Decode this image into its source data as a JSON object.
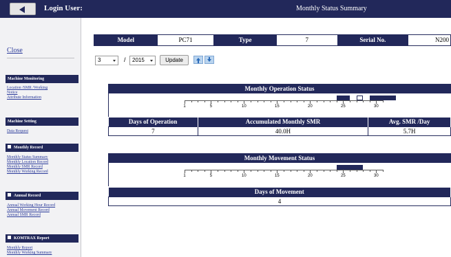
{
  "header": {
    "login_label": "Login User:",
    "page_title": "Monthly Status Summary"
  },
  "sidebar": {
    "close_label": "Close",
    "sections": [
      {
        "title": "Machine Monitoring",
        "has_minus": false,
        "links": [
          "Location /SMR /Working",
          "Notice",
          "Attribute Information"
        ]
      },
      {
        "title": "Machine Setting",
        "has_minus": false,
        "links": [
          "Data Request"
        ]
      },
      {
        "title": "Monthly Record",
        "has_minus": true,
        "links": [
          "Monthly Status Summary",
          "Monthly Location Record",
          "Monthly SMR Record",
          "Monthly Working Record"
        ]
      },
      {
        "title": "Annual Record",
        "has_minus": true,
        "links": [
          "Annual Working Hour Record",
          "Annual Movement Record",
          "Annual SMR Record"
        ]
      },
      {
        "title": "KOMTRAX Report",
        "has_minus": true,
        "links": [
          "Monthly Report",
          "Monthly Working Summary"
        ]
      }
    ]
  },
  "machine": {
    "model_label": "Model",
    "model_value": "PC71",
    "type_label": "Type",
    "type_value": "7",
    "serial_label": "Serial No.",
    "serial_value": "N200"
  },
  "controls": {
    "month_value": "3",
    "separator": "/",
    "year_value": "2015",
    "update_label": "Update"
  },
  "operation": {
    "title": "Monthly Operation Status",
    "axis_labels": [
      "1",
      "5",
      "10",
      "15",
      "20",
      "25",
      "30"
    ],
    "active_days": [
      [
        24,
        26
      ],
      [
        29,
        33
      ]
    ],
    "box_days": [
      [
        27,
        28
      ]
    ],
    "columns": [
      "Days of Operation",
      "Accumulated Monthly SMR",
      "Avg. SMR /Day"
    ],
    "values": [
      "7",
      "40.0H",
      "5.7H"
    ]
  },
  "movement": {
    "title": "Monthly Movement Status",
    "axis_labels": [
      "1",
      "5",
      "10",
      "15",
      "20",
      "25",
      "30"
    ],
    "active_days": [
      [
        24,
        28
      ]
    ],
    "columns": [
      "Days of Movement"
    ],
    "values": [
      "4"
    ]
  },
  "colors": {
    "navy": "#22285a",
    "link": "#2a3a9a",
    "sidebar_bg": "#f2f2f4"
  }
}
